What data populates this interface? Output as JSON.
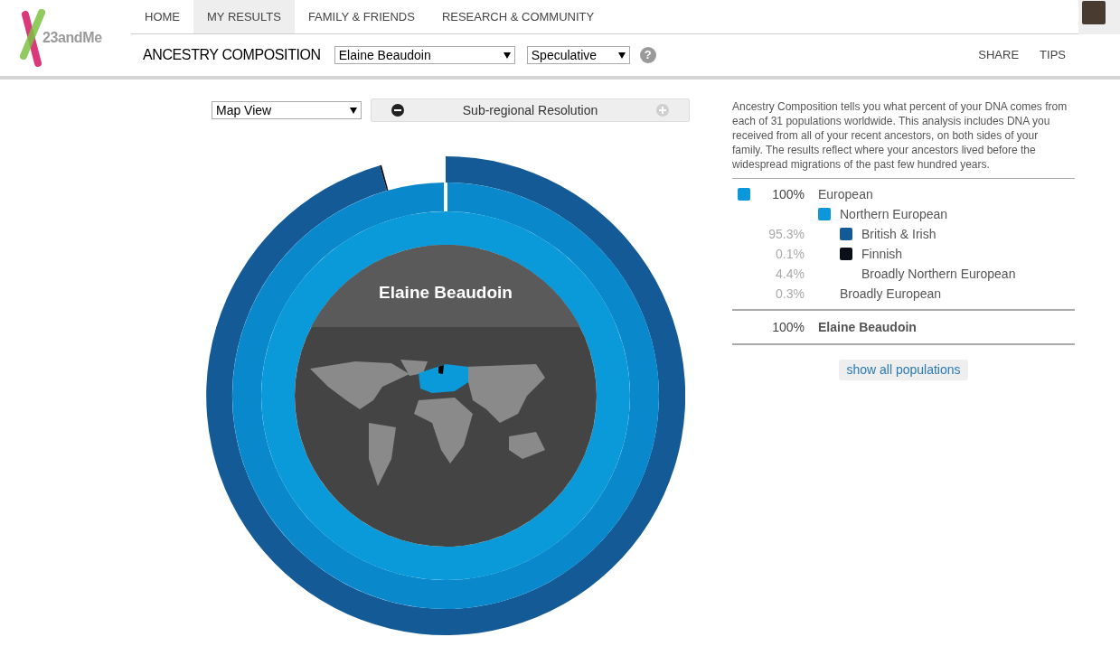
{
  "nav": {
    "logo": "23andMe",
    "tabs": [
      {
        "label": "HOME",
        "selected": false
      },
      {
        "label": "MY RESULTS",
        "selected": true
      },
      {
        "label": "FAMILY & FRIENDS",
        "selected": false
      },
      {
        "label": "RESEARCH & COMMUNITY",
        "selected": false
      }
    ]
  },
  "subnav": {
    "title": "ANCESTRY COMPOSITION",
    "profile_select": "Elaine Beaudoin",
    "confidence_select": "Speculative",
    "help": "?",
    "links": [
      "SHARE",
      "TIPS"
    ]
  },
  "controls": {
    "view_select": "Map View",
    "resolution": "Sub-regional Resolution"
  },
  "chart": {
    "center_label": "Elaine Beaudoin"
  },
  "legend": {
    "description": "Ancestry Composition tells you what percent of your DNA comes from each of 31 populations worldwide. This analysis includes DNA you received from all of your recent ancestors, on both sides of your family. The results reflect where your ancestors lived before the widespread migrations of the past few hundred years.",
    "rows": [
      {
        "percent": "100%",
        "label": "European",
        "color": "#0b97d9",
        "children": [
          {
            "label": "Northern European",
            "color": "#0b97d9",
            "children": [
              {
                "percent": "95.3%",
                "label": "British & Irish",
                "color": "#135a96"
              },
              {
                "percent": "0.1%",
                "label": "Finnish",
                "color": "#0a0f18"
              },
              {
                "percent": "4.4%",
                "label": "Broadly Northern European"
              }
            ]
          },
          {
            "percent": "0.3%",
            "label": "Broadly European"
          }
        ]
      }
    ],
    "total": {
      "percent": "100%",
      "label": "Elaine Beaudoin"
    },
    "button": "show all populations"
  }
}
